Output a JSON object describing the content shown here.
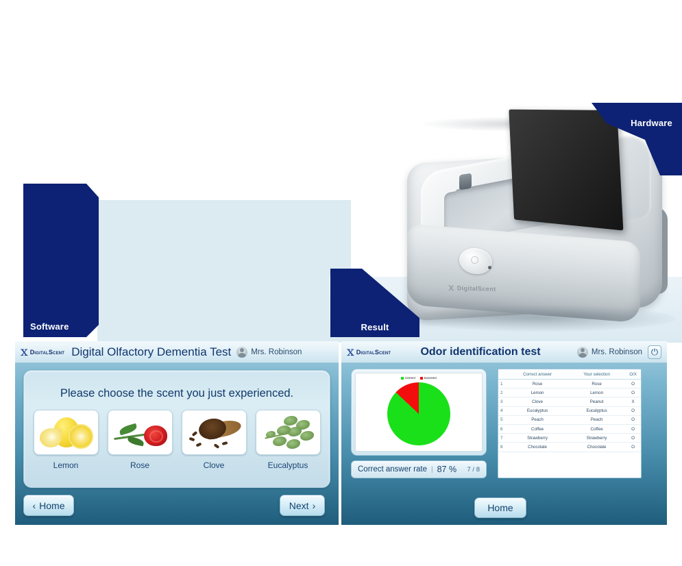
{
  "tabs": {
    "software": "Software",
    "result": "Result",
    "hardware": "Hardware"
  },
  "brand": {
    "name": "DigitalScent",
    "flame_icon": "flame-logo-icon"
  },
  "device": {
    "logo_text": "DigitalScent"
  },
  "software_app": {
    "title": "Digital Olfactory Dementia Test",
    "user": "Mrs. Robinson",
    "prompt": "Please choose the scent you just experienced.",
    "choices": [
      {
        "label": "Lemon",
        "image": "lemon-photo"
      },
      {
        "label": "Rose",
        "image": "rose-photo"
      },
      {
        "label": "Clove",
        "image": "clove-photo"
      },
      {
        "label": "Eucalyptus",
        "image": "eucalyptus-photo"
      }
    ],
    "home_button": "Home",
    "next_button": "Next",
    "back_chevron": "‹",
    "next_chevron": "›"
  },
  "result_app": {
    "title": "Odor identification test",
    "user": "Mrs. Robinson",
    "power_icon": "⏻",
    "rate_label": "Correct answer rate",
    "rate_separator": "|",
    "rate_value": "87 %",
    "rate_count": "7 / 8",
    "home_button": "Home",
    "table": {
      "columns": [
        "",
        "Correct answer",
        "Your selection",
        "O/X"
      ],
      "rows": [
        [
          "1",
          "Rose",
          "Rose",
          "O"
        ],
        [
          "2",
          "Lemon",
          "Lemon",
          "O"
        ],
        [
          "3",
          "Clove",
          "Peanut",
          "X"
        ],
        [
          "4",
          "Eucalyptus",
          "Eucalyptus",
          "O"
        ],
        [
          "5",
          "Peach",
          "Peach",
          "O"
        ],
        [
          "6",
          "Coffee",
          "Coffee",
          "O"
        ],
        [
          "7",
          "Strawberry",
          "Strawberry",
          "O"
        ],
        [
          "8",
          "Chocolate",
          "Chocolate",
          "O"
        ]
      ]
    }
  },
  "chart_data": {
    "type": "pie",
    "title": "",
    "labels": [
      "Correct",
      "Incorrect"
    ],
    "values": [
      87,
      13
    ],
    "colors": [
      "#19e019",
      "#f40d0d"
    ],
    "legend_position": "top",
    "start_angle": 0
  },
  "colors": {
    "navy_tab": "#0d2274",
    "panel_top": "#a5cfe0",
    "panel_bottom": "#1f5d7c",
    "pale_backdrop": "#dceaf2",
    "correct_green": "#19e019",
    "incorrect_red": "#f40d0d"
  }
}
